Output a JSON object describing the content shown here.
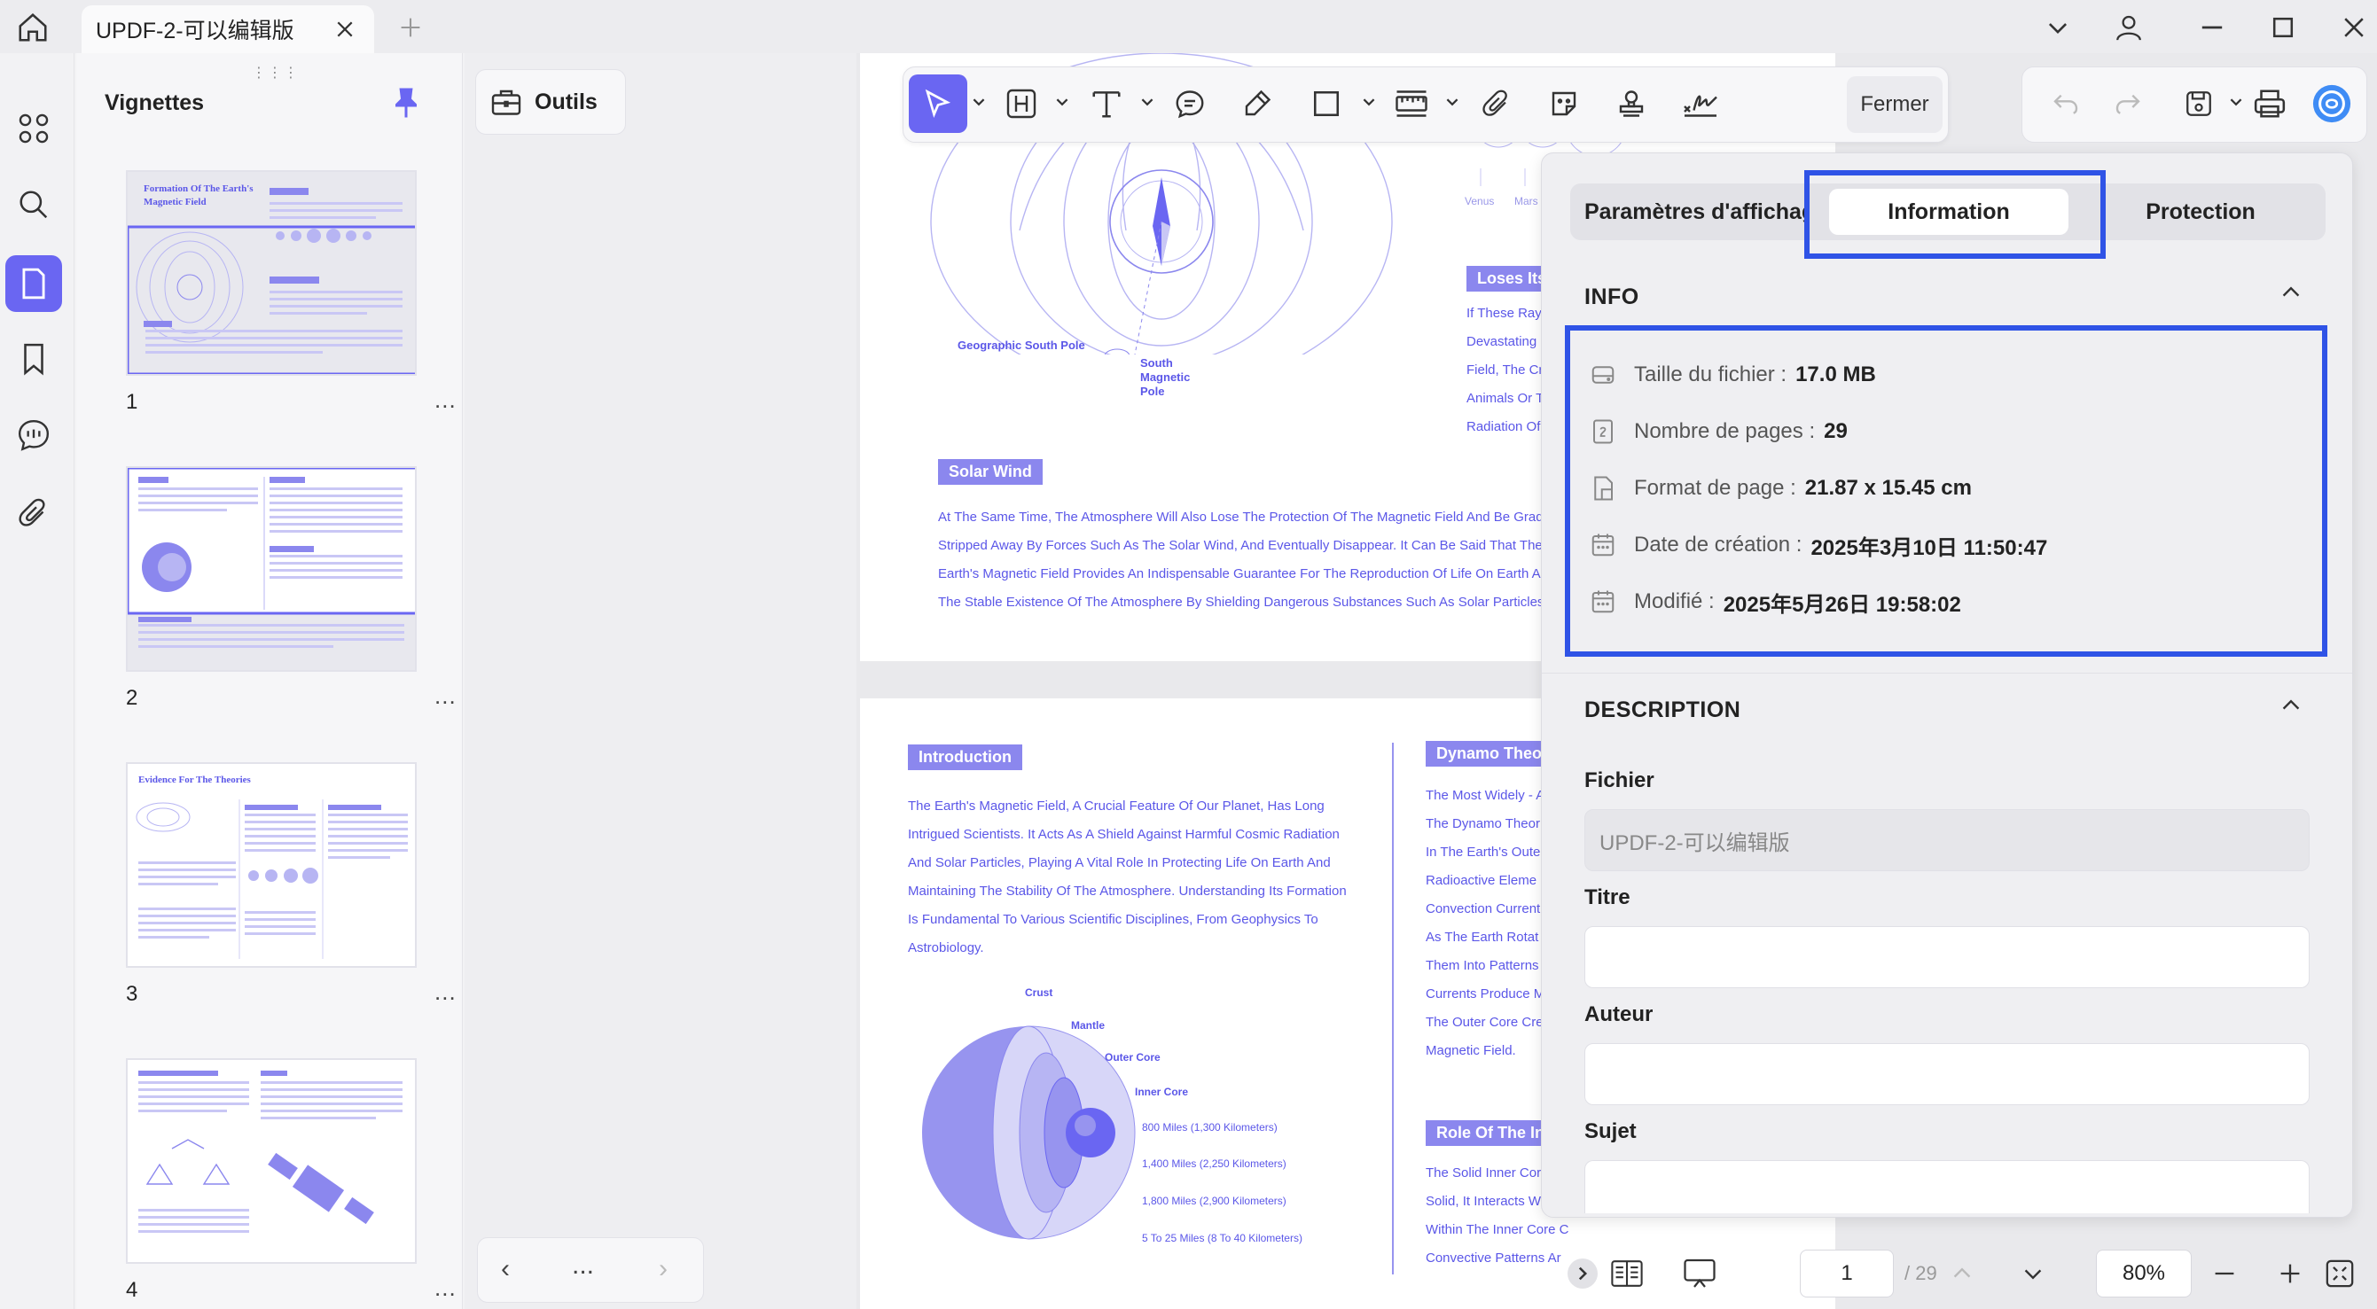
{
  "titlebar": {
    "tab_title": "UPDF-2-可以编辑版"
  },
  "thumbs_panel": {
    "title": "Vignettes",
    "pages": [
      {
        "number": "1",
        "heading": "Formation Of The Earth's Magnetic Field"
      },
      {
        "number": "2"
      },
      {
        "number": "3",
        "heading": "Evidence For The Theories"
      },
      {
        "number": "4"
      }
    ],
    "more": "..."
  },
  "middle": {
    "outils_label": "Outils",
    "pager_more": "..."
  },
  "toolbar": {
    "close_label": "Fermer"
  },
  "document": {
    "page1": {
      "labels": [
        "Geographic South Pole",
        "South Magnetic Pole"
      ],
      "planets": [
        "Venus",
        "Mars"
      ],
      "badge_loses": "Loses Its",
      "right_lines": [
        "If These Rays",
        "Devastating B",
        "Field, The Cre",
        "Animals Or Ti",
        "Radiation Of S"
      ],
      "solar_wind": "Solar Wind",
      "solar_lines": [
        "At The Same Time, The Atmosphere Will Also Lose The Protection Of The Magnetic Field And Be Grad",
        "Stripped Away By Forces Such As The Solar Wind, And Eventually Disappear. It Can Be Said That The",
        "Earth's Magnetic Field Provides An Indispensable Guarantee For The Reproduction Of Life On Earth A",
        "The Stable Existence Of The Atmosphere By Shielding Dangerous Substances Such As Solar Particles"
      ]
    },
    "page2": {
      "intro_badge": "Introduction",
      "intro_lines": [
        "The Earth's Magnetic Field, A Crucial Feature Of Our Planet, Has Long",
        "Intrigued Scientists. It Acts As A Shield Against Harmful Cosmic Radiation",
        "And Solar Particles, Playing A Vital Role In Protecting Life On Earth And",
        "Maintaining The Stability Of The Atmosphere. Understanding Its Formation",
        "Is Fundamental To Various Scientific Disciplines, From Geophysics To",
        "Astrobiology."
      ],
      "layers": [
        "Crust",
        "Mantle",
        "Outer Core",
        "Inner Core"
      ],
      "depths": [
        "800 Miles (1,300 Kilometers)",
        "1,400 Miles (2,250 Kilometers)",
        "1,800 Miles (2,900 Kilometers)",
        "5 To 25 Miles (8 To 40 Kilometers)"
      ],
      "dynamo_badge": "Dynamo Theo",
      "dynamo_lines": [
        "The Most Widely - A",
        "The Dynamo Theor",
        "In The Earth's Oute",
        "Radioactive Eleme",
        "Convection Current",
        "As The Earth Rotat",
        "Them Into Patterns",
        "Currents Produce M",
        "The Outer Core Cre",
        "Magnetic Field."
      ],
      "role_badge": "Role Of The In",
      "role_lines": [
        "The Solid Inner Cor",
        "Solid, It Interacts Wi",
        "Within The Inner Core C",
        "Convective Patterns Ar"
      ]
    }
  },
  "properties": {
    "tabs": [
      "Paramètres d'affichage",
      "Information",
      "Protection"
    ],
    "active_tab": "Information",
    "info_title": "INFO",
    "info": [
      {
        "label": "Taille du fichier :",
        "value": "17.0 MB",
        "icon": "drive-icon"
      },
      {
        "label": "Nombre de pages :",
        "value": "29",
        "icon": "page-count-icon"
      },
      {
        "label": "Format de page :",
        "value": "21.87 x 15.45 cm",
        "icon": "page-format-icon"
      },
      {
        "label": "Date de création :",
        "value": "2025年3月10日 11:50:47",
        "icon": "calendar-icon"
      },
      {
        "label": "Modifié :",
        "value": "2025年5月26日 19:58:02",
        "icon": "calendar-icon"
      }
    ],
    "description_title": "DESCRIPTION",
    "fields": [
      {
        "label": "Fichier",
        "value": "UPDF-2-可以编辑版"
      },
      {
        "label": "Titre",
        "value": ""
      },
      {
        "label": "Auteur",
        "value": ""
      },
      {
        "label": "Sujet",
        "value": ""
      }
    ]
  },
  "statusbar": {
    "page_input": "1",
    "page_total": "/ 29",
    "zoom": "80%"
  },
  "colors": {
    "accent": "#6a66f2",
    "highlight": "#2f53e6",
    "doc_text": "#5b57e8"
  }
}
